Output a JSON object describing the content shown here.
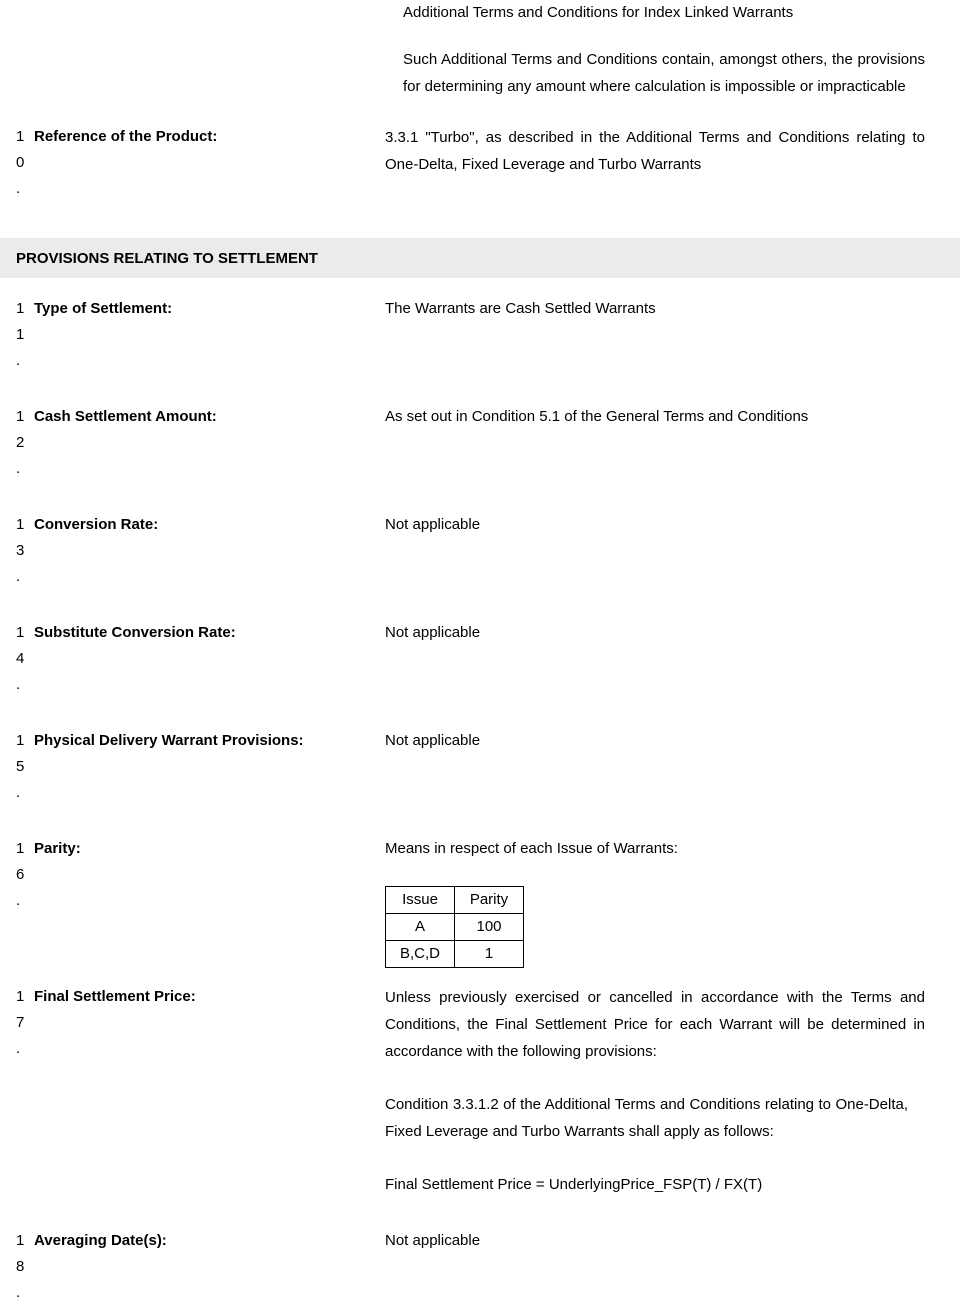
{
  "intro": {
    "title": "Additional Terms and Conditions for Index Linked Warrants",
    "paragraph": "Such Additional Terms and Conditions contain, amongst others, the provisions for determining any amount where calculation is impossible or impracticable"
  },
  "section_heading": "PROVISIONS RELATING TO SETTLEMENT",
  "rows": [
    {
      "number": "10.",
      "label": "Reference of the Product:",
      "value": "3.3.1 \"Turbo\", as described in the Additional Terms and Conditions relating to One-Delta, Fixed Leverage and Turbo Warrants"
    },
    {
      "number": "11.",
      "label": "Type of Settlement:",
      "value": "The Warrants are Cash Settled Warrants"
    },
    {
      "number": "12.",
      "label": "Cash Settlement Amount:",
      "value": "As set out in Condition 5.1 of the General Terms and Conditions"
    },
    {
      "number": "13.",
      "label": "Conversion Rate:",
      "value": "Not applicable"
    },
    {
      "number": "14.",
      "label": "Substitute Conversion Rate:",
      "value": "Not applicable"
    },
    {
      "number": "15.",
      "label": "Physical Delivery Warrant Provisions:",
      "value": "Not applicable"
    },
    {
      "number": "16.",
      "label": "Parity:",
      "value": "Means in respect of each Issue of Warrants:"
    },
    {
      "number": "17.",
      "label": "Final Settlement Price:",
      "value": "Unless previously exercised or cancelled in accordance with the Terms and Conditions, the Final Settlement Price for each Warrant will be determined in accordance with the following provisions:"
    },
    {
      "number": "18.",
      "label": "Averaging Date(s):",
      "value": "Not applicable"
    }
  ],
  "parity_table": {
    "headers": [
      "Issue",
      "Parity"
    ],
    "rows": [
      [
        "A",
        "100"
      ],
      [
        "B,C,D",
        "1"
      ]
    ]
  },
  "fsp": {
    "condition_para": "Condition 3.3.1.2 of the Additional Terms and Conditions relating to One-Delta, Fixed Leverage and Turbo Warrants shall apply as follows:",
    "formula": "Final Settlement Price = UnderlyingPrice_FSP(T) / FX(T)"
  }
}
